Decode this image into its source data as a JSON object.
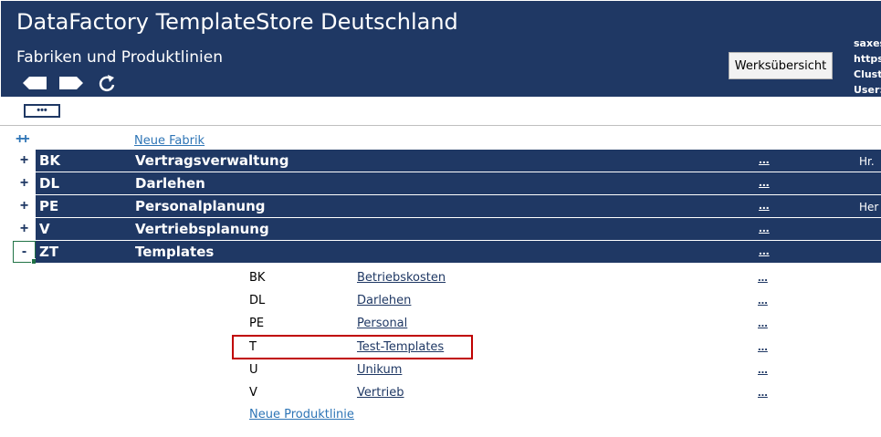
{
  "header": {
    "title": "DataFactory TemplateStore Deutschland",
    "subtitle": "Fabriken und Produktlinien",
    "werks_button": "Werksübersicht",
    "info_lines": [
      "saxes",
      "https:",
      "Cluste",
      "User:"
    ],
    "bg_color": "#1f3864"
  },
  "toolbar": {
    "more_label": "•••"
  },
  "factories": {
    "expand_all": "++",
    "new_label": "Neue Fabrik",
    "rows": [
      {
        "toggle": "+",
        "code": "BK",
        "name": "Vertragsverwaltung",
        "more": "...",
        "right": "Hr."
      },
      {
        "toggle": "+",
        "code": "DL",
        "name": "Darlehen",
        "more": "...",
        "right": ""
      },
      {
        "toggle": "+",
        "code": "PE",
        "name": "Personalplanung",
        "more": "...",
        "right": "Her"
      },
      {
        "toggle": "+",
        "code": "V",
        "name": "Vertriebsplanung",
        "more": "...",
        "right": ""
      },
      {
        "toggle": "-",
        "code": "ZT",
        "name": "Templates",
        "more": "...",
        "right": ""
      }
    ]
  },
  "product_lines": {
    "rows": [
      {
        "code": "BK",
        "name": "Betriebskosten",
        "more": "..."
      },
      {
        "code": "DL",
        "name": "Darlehen",
        "more": "..."
      },
      {
        "code": "PE",
        "name": "Personal",
        "more": "..."
      },
      {
        "code": "T",
        "name": "Test-Templates",
        "more": "..."
      },
      {
        "code": "U",
        "name": "Unikum",
        "more": "..."
      },
      {
        "code": "V",
        "name": "Vertrieb",
        "more": "..."
      }
    ],
    "new_label": "Neue Produktlinie"
  }
}
